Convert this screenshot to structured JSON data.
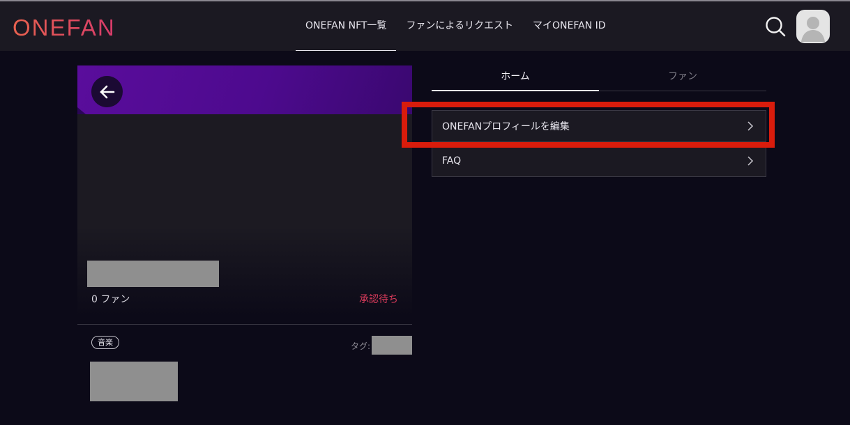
{
  "header": {
    "logo": "ONEFAN",
    "nav": [
      {
        "label": "ONEFAN NFT一覧",
        "active": true
      },
      {
        "label": "ファンによるリクエスト",
        "active": false
      },
      {
        "label": "マイONEFAN ID",
        "active": false
      }
    ],
    "icons": {
      "search": "search-icon",
      "avatar": "user-avatar-icon"
    }
  },
  "profile": {
    "back_icon": "arrow-left-icon",
    "fans": "0 ファン",
    "status": "承認待ち",
    "genre_chip": "音楽",
    "tag_label": "タグ:"
  },
  "tabs": [
    {
      "label": "ホーム",
      "active": true
    },
    {
      "label": "ファン",
      "active": false
    }
  ],
  "menu": [
    {
      "label": "ONEFANプロフィールを編集",
      "icon": "chevron-right-icon"
    },
    {
      "label": "FAQ",
      "icon": "chevron-right-icon"
    }
  ],
  "colors": {
    "brand_gradient_start": "#e9624f",
    "brand_gradient_end": "#d63a6a",
    "banner": "#5a0d9c",
    "status": "#d63a5a",
    "highlight": "#d91c0c",
    "background": "#0c0a18"
  }
}
